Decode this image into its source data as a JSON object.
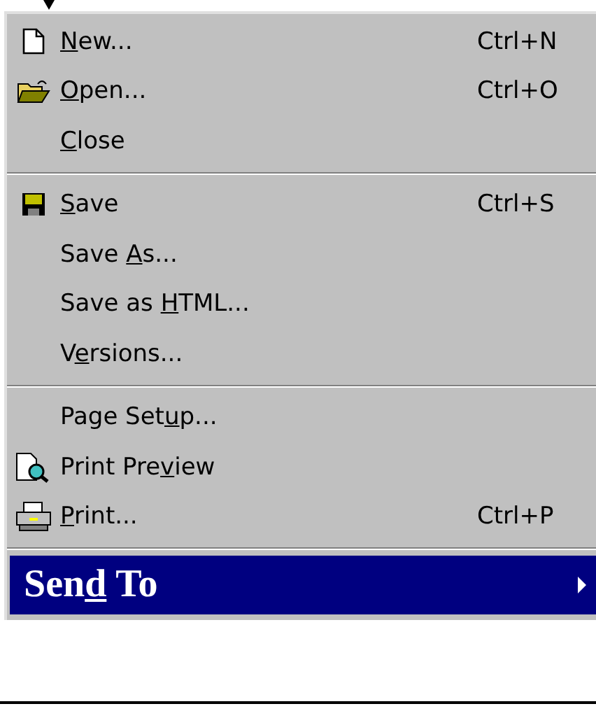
{
  "menu": {
    "items": [
      {
        "kind": "item",
        "label": {
          "key": "N",
          "after": "ew..."
        },
        "shortcut": "Ctrl+N",
        "selected": false
      },
      {
        "kind": "item",
        "label": {
          "key": "O",
          "after": "pen..."
        },
        "shortcut": "Ctrl+O",
        "selected": false
      },
      {
        "kind": "item",
        "label": {
          "key": "C",
          "after": "lose"
        },
        "selected": false
      },
      {
        "kind": "separator"
      },
      {
        "kind": "item",
        "label": {
          "key": "S",
          "after": "ave"
        },
        "shortcut": "Ctrl+S",
        "selected": false
      },
      {
        "kind": "item",
        "label": {
          "before": "Save ",
          "key": "A",
          "after": "s..."
        },
        "selected": false
      },
      {
        "kind": "item",
        "label": {
          "before": "Save as ",
          "key": "H",
          "after": "TML..."
        },
        "selected": false
      },
      {
        "kind": "item",
        "label": {
          "before": "V",
          "key": "e",
          "after": "rsions..."
        },
        "selected": false
      },
      {
        "kind": "separator"
      },
      {
        "kind": "item",
        "label": {
          "before": "Page Set",
          "key": "u",
          "after": "p..."
        },
        "selected": false
      },
      {
        "kind": "item",
        "label": {
          "before": "Print Pre",
          "key": "v",
          "after": "iew"
        },
        "selected": false
      },
      {
        "kind": "item",
        "label": {
          "key": "P",
          "after": "rint..."
        },
        "shortcut": "Ctrl+P",
        "selected": false
      },
      {
        "kind": "separator"
      },
      {
        "kind": "submenu",
        "label": {
          "before": "Sen",
          "key": "d",
          "after": " To"
        },
        "selected": true
      }
    ]
  }
}
